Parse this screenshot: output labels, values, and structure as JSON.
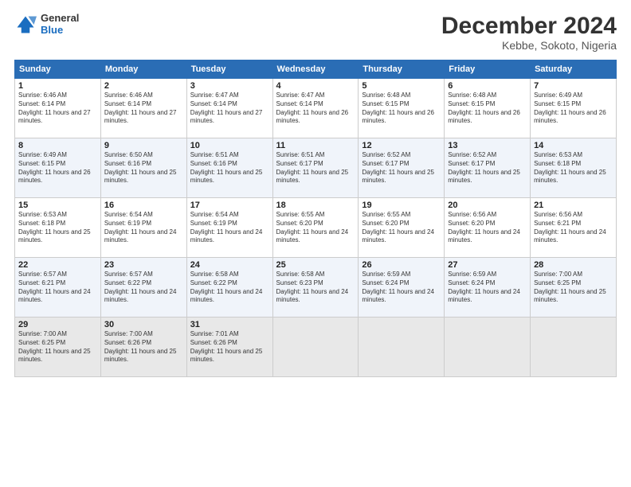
{
  "header": {
    "logo_general": "General",
    "logo_blue": "Blue",
    "month_title": "December 2024",
    "location": "Kebbe, Sokoto, Nigeria"
  },
  "days_of_week": [
    "Sunday",
    "Monday",
    "Tuesday",
    "Wednesday",
    "Thursday",
    "Friday",
    "Saturday"
  ],
  "weeks": [
    [
      {
        "day": "1",
        "sunrise": "6:46 AM",
        "sunset": "6:14 PM",
        "daylight": "11 hours and 27 minutes."
      },
      {
        "day": "2",
        "sunrise": "6:46 AM",
        "sunset": "6:14 PM",
        "daylight": "11 hours and 27 minutes."
      },
      {
        "day": "3",
        "sunrise": "6:47 AM",
        "sunset": "6:14 PM",
        "daylight": "11 hours and 27 minutes."
      },
      {
        "day": "4",
        "sunrise": "6:47 AM",
        "sunset": "6:14 PM",
        "daylight": "11 hours and 26 minutes."
      },
      {
        "day": "5",
        "sunrise": "6:48 AM",
        "sunset": "6:15 PM",
        "daylight": "11 hours and 26 minutes."
      },
      {
        "day": "6",
        "sunrise": "6:48 AM",
        "sunset": "6:15 PM",
        "daylight": "11 hours and 26 minutes."
      },
      {
        "day": "7",
        "sunrise": "6:49 AM",
        "sunset": "6:15 PM",
        "daylight": "11 hours and 26 minutes."
      }
    ],
    [
      {
        "day": "8",
        "sunrise": "6:49 AM",
        "sunset": "6:15 PM",
        "daylight": "11 hours and 26 minutes."
      },
      {
        "day": "9",
        "sunrise": "6:50 AM",
        "sunset": "6:16 PM",
        "daylight": "11 hours and 25 minutes."
      },
      {
        "day": "10",
        "sunrise": "6:51 AM",
        "sunset": "6:16 PM",
        "daylight": "11 hours and 25 minutes."
      },
      {
        "day": "11",
        "sunrise": "6:51 AM",
        "sunset": "6:17 PM",
        "daylight": "11 hours and 25 minutes."
      },
      {
        "day": "12",
        "sunrise": "6:52 AM",
        "sunset": "6:17 PM",
        "daylight": "11 hours and 25 minutes."
      },
      {
        "day": "13",
        "sunrise": "6:52 AM",
        "sunset": "6:17 PM",
        "daylight": "11 hours and 25 minutes."
      },
      {
        "day": "14",
        "sunrise": "6:53 AM",
        "sunset": "6:18 PM",
        "daylight": "11 hours and 25 minutes."
      }
    ],
    [
      {
        "day": "15",
        "sunrise": "6:53 AM",
        "sunset": "6:18 PM",
        "daylight": "11 hours and 25 minutes."
      },
      {
        "day": "16",
        "sunrise": "6:54 AM",
        "sunset": "6:19 PM",
        "daylight": "11 hours and 24 minutes."
      },
      {
        "day": "17",
        "sunrise": "6:54 AM",
        "sunset": "6:19 PM",
        "daylight": "11 hours and 24 minutes."
      },
      {
        "day": "18",
        "sunrise": "6:55 AM",
        "sunset": "6:20 PM",
        "daylight": "11 hours and 24 minutes."
      },
      {
        "day": "19",
        "sunrise": "6:55 AM",
        "sunset": "6:20 PM",
        "daylight": "11 hours and 24 minutes."
      },
      {
        "day": "20",
        "sunrise": "6:56 AM",
        "sunset": "6:20 PM",
        "daylight": "11 hours and 24 minutes."
      },
      {
        "day": "21",
        "sunrise": "6:56 AM",
        "sunset": "6:21 PM",
        "daylight": "11 hours and 24 minutes."
      }
    ],
    [
      {
        "day": "22",
        "sunrise": "6:57 AM",
        "sunset": "6:21 PM",
        "daylight": "11 hours and 24 minutes."
      },
      {
        "day": "23",
        "sunrise": "6:57 AM",
        "sunset": "6:22 PM",
        "daylight": "11 hours and 24 minutes."
      },
      {
        "day": "24",
        "sunrise": "6:58 AM",
        "sunset": "6:22 PM",
        "daylight": "11 hours and 24 minutes."
      },
      {
        "day": "25",
        "sunrise": "6:58 AM",
        "sunset": "6:23 PM",
        "daylight": "11 hours and 24 minutes."
      },
      {
        "day": "26",
        "sunrise": "6:59 AM",
        "sunset": "6:24 PM",
        "daylight": "11 hours and 24 minutes."
      },
      {
        "day": "27",
        "sunrise": "6:59 AM",
        "sunset": "6:24 PM",
        "daylight": "11 hours and 24 minutes."
      },
      {
        "day": "28",
        "sunrise": "7:00 AM",
        "sunset": "6:25 PM",
        "daylight": "11 hours and 25 minutes."
      }
    ],
    [
      {
        "day": "29",
        "sunrise": "7:00 AM",
        "sunset": "6:25 PM",
        "daylight": "11 hours and 25 minutes."
      },
      {
        "day": "30",
        "sunrise": "7:00 AM",
        "sunset": "6:26 PM",
        "daylight": "11 hours and 25 minutes."
      },
      {
        "day": "31",
        "sunrise": "7:01 AM",
        "sunset": "6:26 PM",
        "daylight": "11 hours and 25 minutes."
      },
      null,
      null,
      null,
      null
    ]
  ]
}
